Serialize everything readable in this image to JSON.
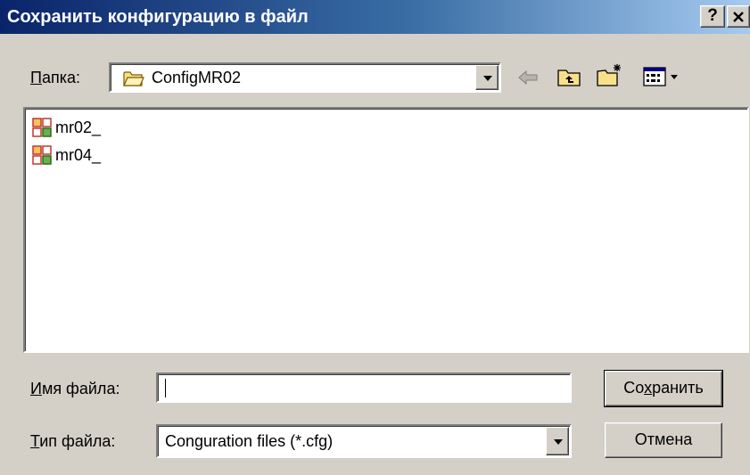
{
  "window": {
    "title": "Сохранить конфигурацию в файл",
    "help_label": "?",
    "close_label": "✕"
  },
  "folder": {
    "label_accel": "П",
    "label_rest": "апка:",
    "current": "ConfigMR02",
    "icon": "folder-icon"
  },
  "toolbar": {
    "back_icon": "back-arrow-icon",
    "up_icon": "up-folder-icon",
    "new_folder_icon": "new-folder-icon",
    "view_icon": "view-menu-icon"
  },
  "files": [
    {
      "name": "mr02_",
      "icon": "config-file-icon"
    },
    {
      "name": "mr04_",
      "icon": "config-file-icon"
    }
  ],
  "filename": {
    "label_accel": "И",
    "label_rest": "мя файла:",
    "value": ""
  },
  "filetype": {
    "label_accel": "Т",
    "label_rest": "ип файла:",
    "selected": "Conguration files (*.cfg)"
  },
  "buttons": {
    "save_pre": "Со",
    "save_accel": "х",
    "save_post": "ранить",
    "cancel": "Отмена"
  },
  "colors": {
    "title_start": "#0a246a",
    "title_end": "#a6caf0",
    "face": "#d4d0c8"
  }
}
